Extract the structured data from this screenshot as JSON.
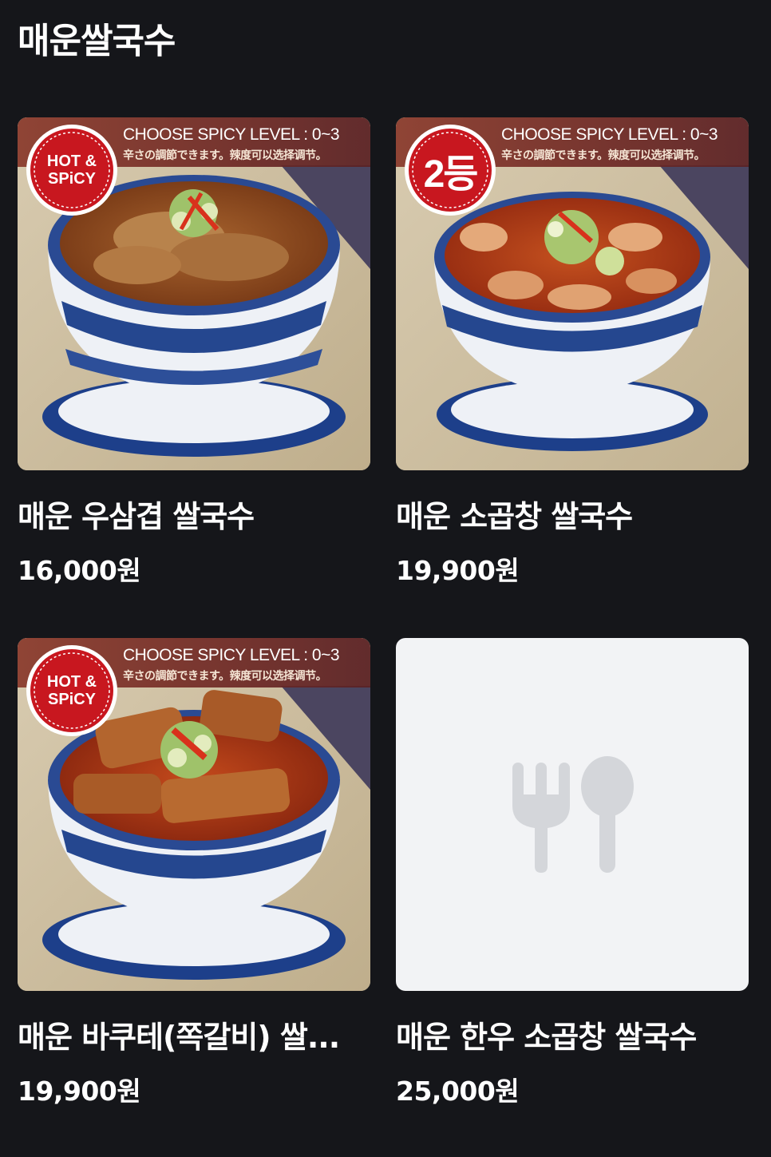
{
  "section": {
    "title": "매운쌀국수"
  },
  "banner": {
    "line1": "CHOOSE SPICY LEVEL : 0~3",
    "line2": "辛さの調節できます。辣度可以选择调节。"
  },
  "items": [
    {
      "name": "매운 우삼겹 쌀국수",
      "price": "16,000원",
      "badge": "HOT & SPiCY",
      "badge_line1": "HOT &",
      "badge_line2": "SPiCY",
      "image": "spicy-beef-brisket-noodle-bowl"
    },
    {
      "name": "매운 소곱창 쌀국수",
      "price": "19,900원",
      "badge": "2등",
      "image": "spicy-beef-intestine-noodle-bowl"
    },
    {
      "name": "매운 바쿠테(쪽갈비) 쌀...",
      "price": "19,900원",
      "badge": "HOT & SPiCY",
      "badge_line1": "HOT &",
      "badge_line2": "SPiCY",
      "image": "spicy-bakuteh-rib-noodle-bowl"
    },
    {
      "name": "매운 한우 소곱창 쌀국수",
      "price": "25,000원",
      "image": "fork-spoon-placeholder-icon"
    }
  ],
  "colors": {
    "background": "#15161a",
    "text": "#ffffff",
    "placeholder_bg": "#f2f3f5",
    "placeholder_icon": "#d4d6da",
    "badge_red": "#c8171f"
  }
}
